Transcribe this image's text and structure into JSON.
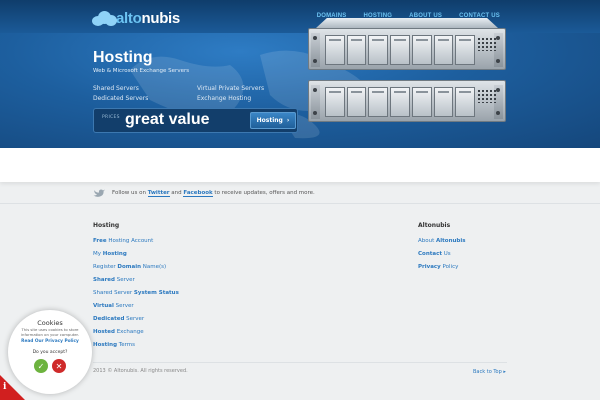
{
  "header": {
    "logo_part1": "alto",
    "logo_part2": "nubis",
    "nav": [
      {
        "label": "DOMAINS"
      },
      {
        "label": "HOSTING"
      },
      {
        "label": "ABOUT US"
      },
      {
        "label": "CONTACT US"
      }
    ]
  },
  "hero": {
    "title": "Hosting",
    "subtitle": "Web & Microsoft Exchange Servers",
    "services": [
      "Shared Servers",
      "Virtual Private Servers",
      "Dedicated Servers",
      "Exchange Hosting"
    ],
    "prices_label": "PRICES",
    "tagline": "great value",
    "button_label": "Hosting",
    "button_arrow": "›"
  },
  "social": {
    "text_before": "Follow us on ",
    "twitter": "Twitter",
    "and": " and ",
    "facebook": "Facebook",
    "text_after": " to receive updates, offers and more."
  },
  "footer": {
    "hosting_heading": "Hosting",
    "hosting_links": [
      {
        "a": "Free",
        "b": " Hosting Account"
      },
      {
        "a": "My ",
        "b": "Hosting"
      },
      {
        "a": "Register ",
        "b": "Domain",
        "c": " Name(s)"
      },
      {
        "a": "Shared",
        "b": " Server"
      },
      {
        "a": "Shared Server ",
        "b": "System Status"
      },
      {
        "a": "Virtual",
        "b": " Server"
      },
      {
        "a": "Dedicated",
        "b": " Server"
      },
      {
        "a": "Hosted",
        "b": " Exchange"
      },
      {
        "a": "Hosting",
        "b": " Terms"
      }
    ],
    "alto_heading": "Altonubis",
    "alto_links": [
      {
        "a": "About ",
        "b": "Altonubis"
      },
      {
        "a": "Contact",
        "b": " Us"
      },
      {
        "a": "Privacy",
        "b": " Policy"
      }
    ],
    "copyright": "2013 © Altonubis. All rights reserved.",
    "back_to_top": "Back to Top ▸"
  },
  "cookie": {
    "title": "Cookies",
    "description": "This site uses cookies to store information on your computer.",
    "link": "Read Our Privacy Policy",
    "question": "Do you accept?",
    "accept_icon": "✓",
    "decline_icon": "✕",
    "badge": "i"
  },
  "colors": {
    "accent": "#2a78bf",
    "hero_bg": "#1d5f9f",
    "accept": "#6db33f",
    "decline": "#cf2a2a"
  }
}
